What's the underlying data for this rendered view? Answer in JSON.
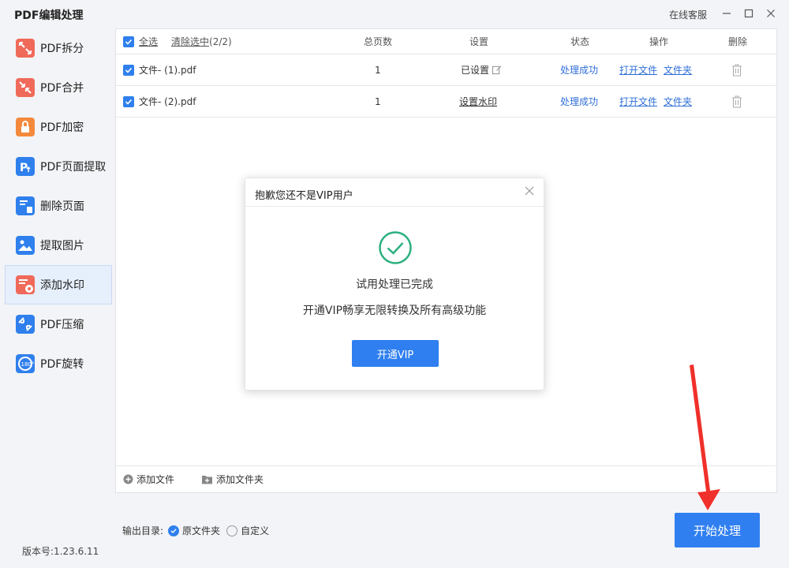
{
  "app": {
    "title": "PDF编辑处理",
    "service_label": "在线客服",
    "version": "版本号:1.23.6.11"
  },
  "sidebar": {
    "items": [
      {
        "label": "PDF拆分",
        "icon": "split-icon",
        "color": "#f06a5a"
      },
      {
        "label": "PDF合并",
        "icon": "merge-icon",
        "color": "#f06a5a"
      },
      {
        "label": "PDF加密",
        "icon": "lock-icon",
        "color": "#f4893c"
      },
      {
        "label": "PDF页面提取",
        "icon": "page-extract-icon",
        "color": "#2f80ed"
      },
      {
        "label": "删除页面",
        "icon": "delete-page-icon",
        "color": "#2f80ed"
      },
      {
        "label": "提取图片",
        "icon": "image-extract-icon",
        "color": "#2f80ed"
      },
      {
        "label": "添加水印",
        "icon": "watermark-icon",
        "color": "#f06a5a",
        "active": true
      },
      {
        "label": "PDF压缩",
        "icon": "compress-icon",
        "color": "#2f80ed"
      },
      {
        "label": "PDF旋转",
        "icon": "rotate-icon",
        "color": "#2f80ed"
      }
    ]
  },
  "table": {
    "select_all": "全选",
    "clear_selected": "清除选中",
    "selected_count": "(2/2)",
    "headers": {
      "pages": "总页数",
      "settings": "设置",
      "status": "状态",
      "actions": "操作",
      "delete": "删除"
    },
    "rows": [
      {
        "name": "文件- (1).pdf",
        "pages": "1",
        "setting": "已设置",
        "status": "处理成功",
        "open": "打开文件",
        "folder": "文件夹"
      },
      {
        "name": "文件- (2).pdf",
        "pages": "1",
        "setting": "设置水印",
        "status": "处理成功",
        "open": "打开文件",
        "folder": "文件夹"
      }
    ],
    "add_file": "添加文件",
    "add_folder": "添加文件夹"
  },
  "output": {
    "label": "输出目录:",
    "option_original": "原文件夹",
    "option_custom": "自定义"
  },
  "start_button": "开始处理",
  "dialog": {
    "title": "抱歉您还不是VIP用户",
    "message1": "试用处理已完成",
    "message2": "开通VIP畅享无限转换及所有高级功能",
    "button": "开通VIP"
  },
  "colors": {
    "accent": "#2f7ff0",
    "success": "#2bb07f",
    "annotation": "#f0302a"
  }
}
